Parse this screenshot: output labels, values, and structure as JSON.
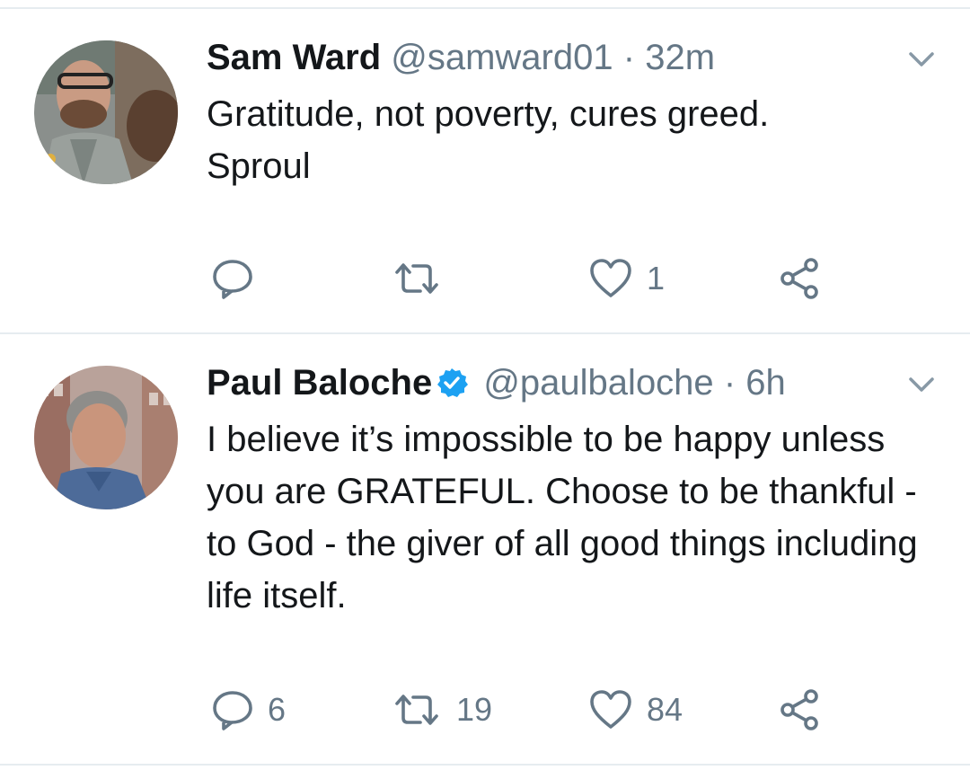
{
  "tweets": [
    {
      "name": "Sam Ward",
      "verified": false,
      "handle": "@samward01",
      "separator": "·",
      "time": "32m",
      "text": "Gratitude, not poverty, cures greed. Sproul",
      "reply_count": "",
      "retweet_count": "",
      "like_count": "1"
    },
    {
      "name": "Paul Baloche",
      "verified": true,
      "handle": "@paulbaloche",
      "separator": "·",
      "time": "6h",
      "text": "I believe it’s impossible to be happy unless you are GRATEFUL. Choose to be thankful - to God - the giver of all good things including life itself.",
      "reply_count": "6",
      "retweet_count": "19",
      "like_count": "84"
    }
  ],
  "icons": {
    "reply": "speech-bubble-icon",
    "retweet": "retweet-arrows-icon",
    "like": "heart-icon",
    "share": "share-icon",
    "more": "chevron-down-icon",
    "verified": "verified-badge-icon"
  },
  "colors": {
    "text": "#14171a",
    "secondary": "#657786",
    "verified": "#1da1f2",
    "divider": "#e6ecf0"
  }
}
